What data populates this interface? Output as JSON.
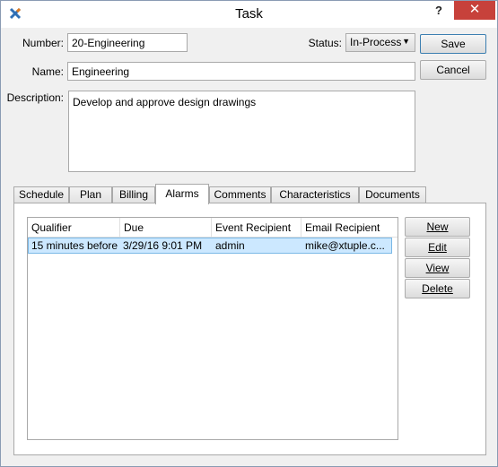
{
  "window": {
    "title": "Task",
    "help_label": "?",
    "close_label": "✕"
  },
  "form": {
    "number_label": "Number:",
    "number_value": "20-Engineering",
    "status_label": "Status:",
    "status_value": "In-Process",
    "name_label": "Name:",
    "name_value": "Engineering",
    "description_label": "Description:",
    "description_value": "Develop and approve design drawings"
  },
  "buttons": {
    "save": "Save",
    "cancel": "Cancel"
  },
  "tabs": [
    {
      "label": "Schedule"
    },
    {
      "label": "Plan"
    },
    {
      "label": "Billing"
    },
    {
      "label": "Alarms"
    },
    {
      "label": "Comments"
    },
    {
      "label": "Characteristics"
    },
    {
      "label": "Documents"
    }
  ],
  "active_tab": "Alarms",
  "alarms": {
    "columns": [
      "Qualifier",
      "Due",
      "Event Recipient",
      "Email Recipient"
    ],
    "rows": [
      {
        "qualifier": "15 minutes before",
        "due": "3/29/16 9:01 PM",
        "event_recipient": "admin",
        "email_recipient": "mike@xtuple.c..."
      }
    ],
    "actions": {
      "new_label": "New",
      "edit_label": "Edit",
      "view_label": "View",
      "delete_label": "Delete"
    }
  },
  "colors": {
    "close_button": "#c7413b",
    "selection": "#cce8ff",
    "selection_border": "#7ab8e6"
  }
}
